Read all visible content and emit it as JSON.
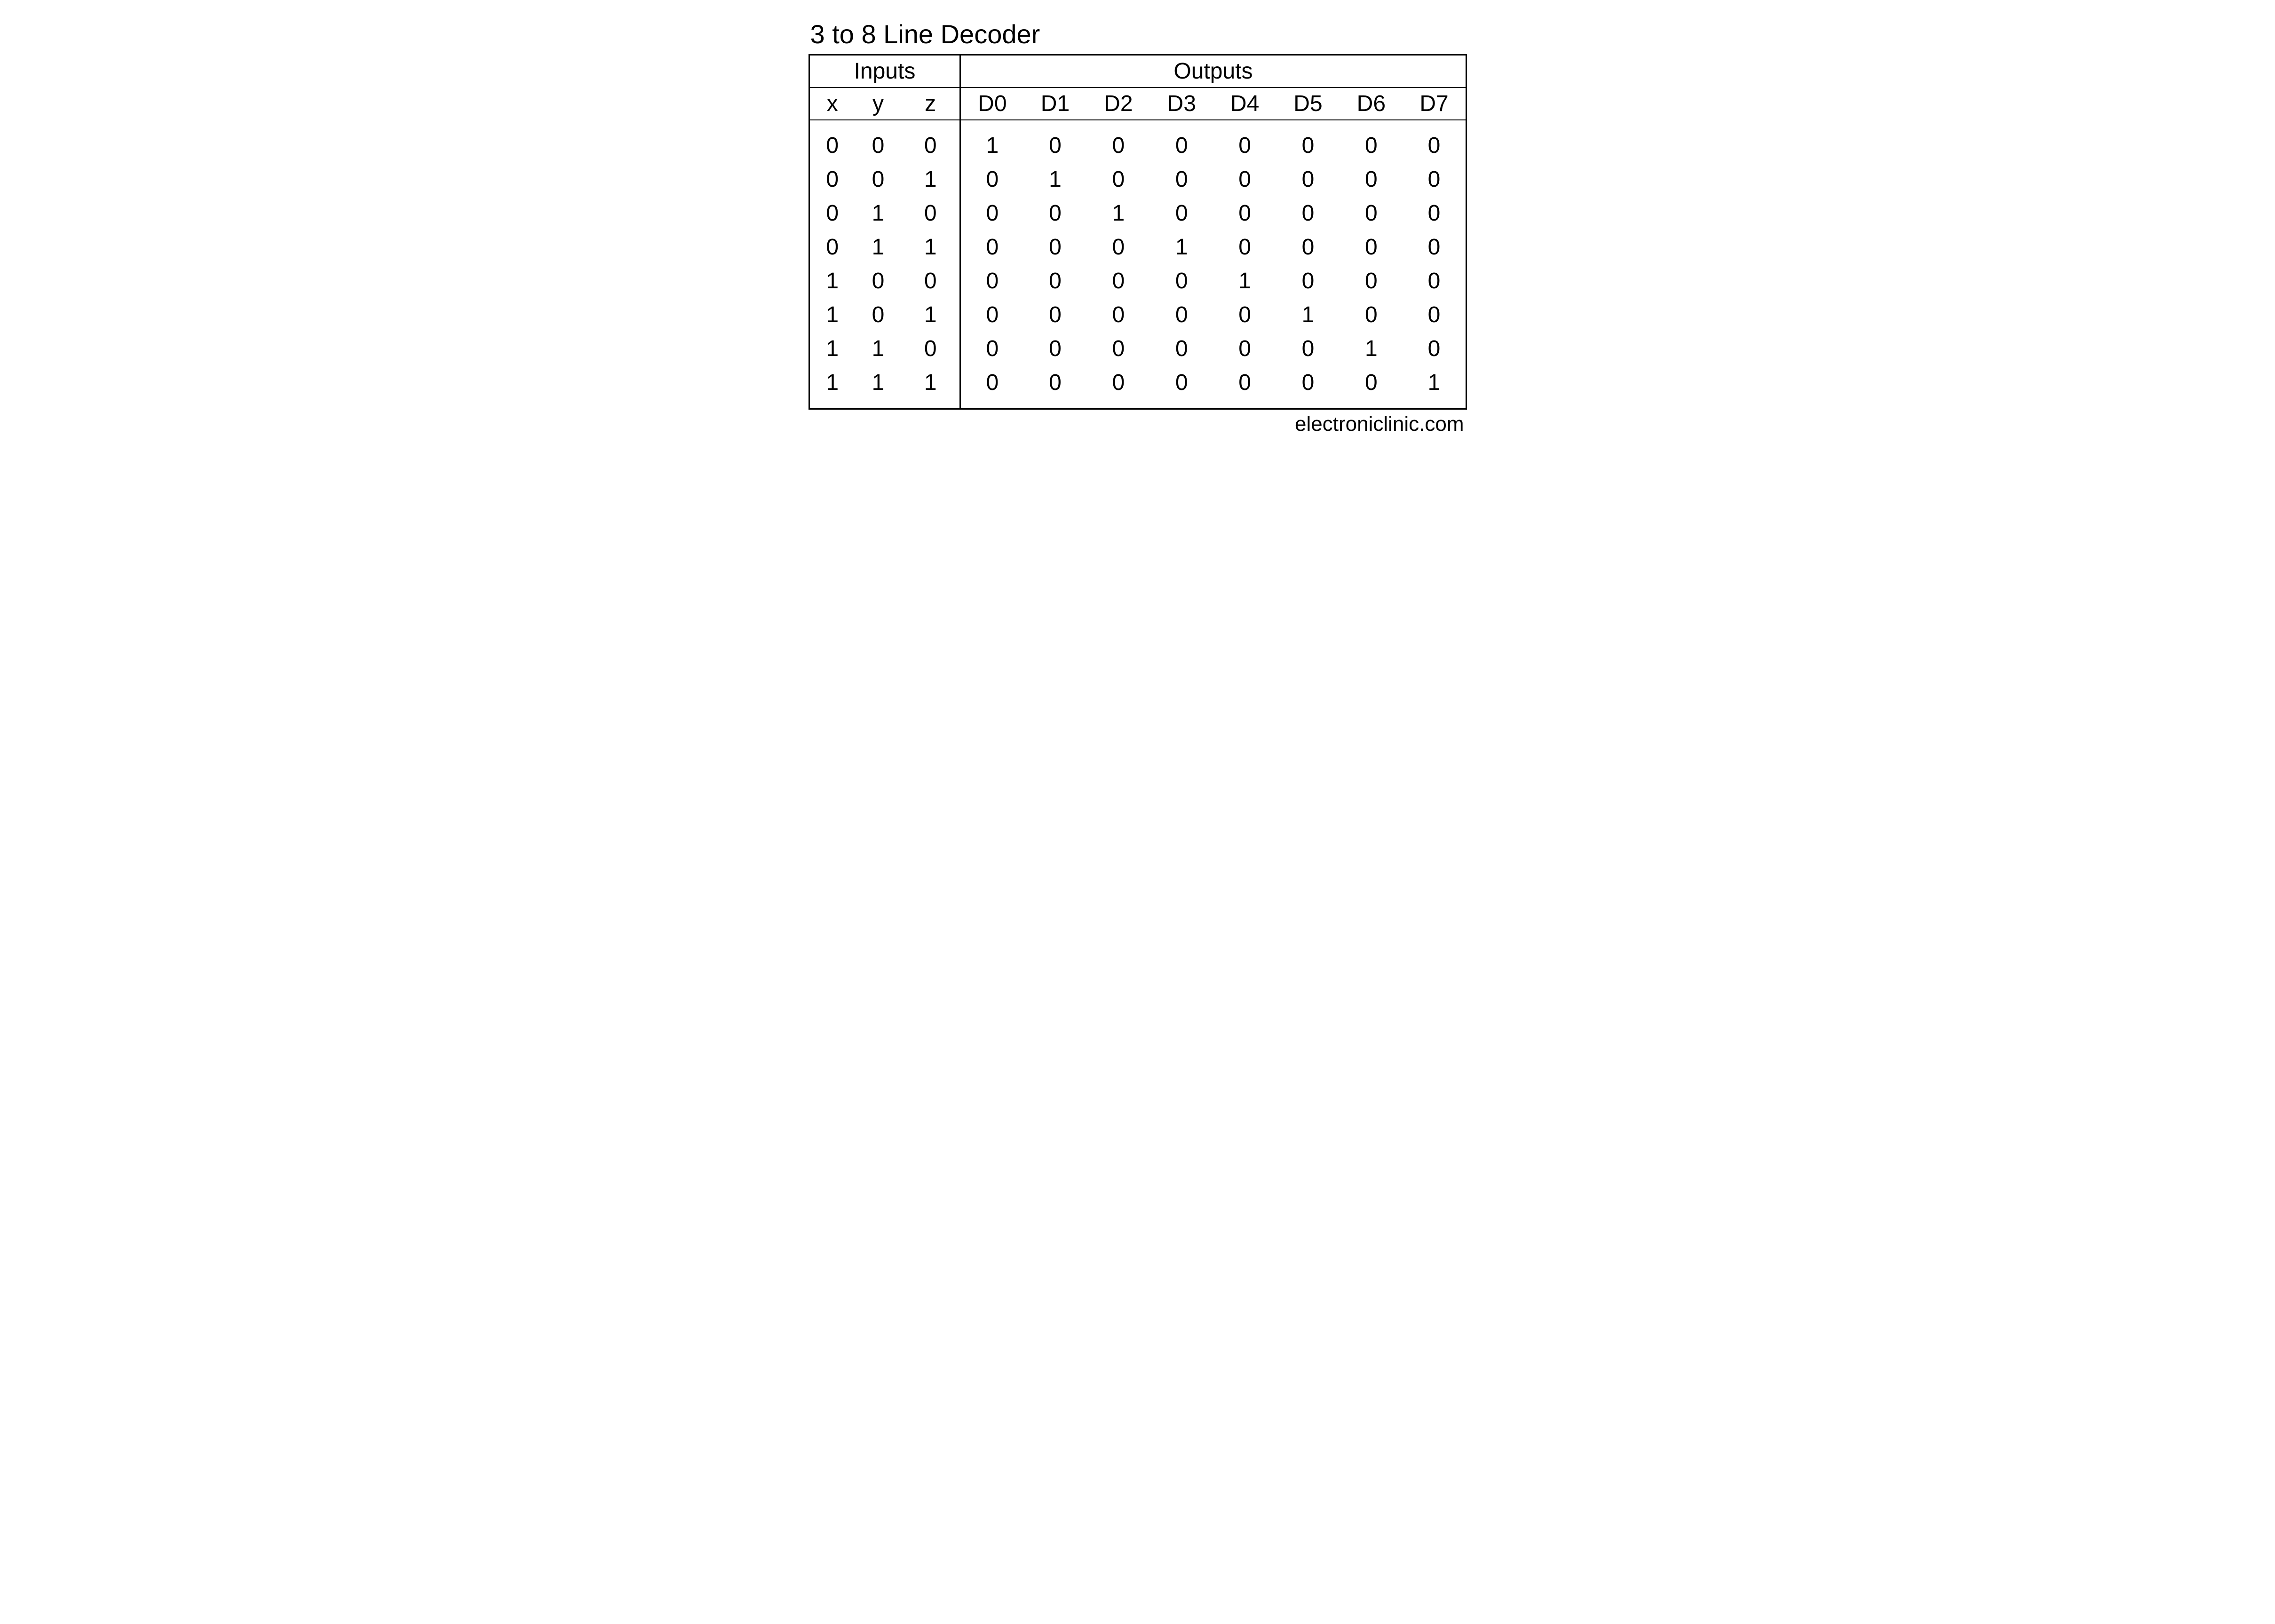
{
  "title": "3 to 8 Line Decoder",
  "credit": "electroniclinic.com",
  "groups": {
    "inputs": "Inputs",
    "outputs": "Outputs"
  },
  "inputs": [
    "x",
    "y",
    "z"
  ],
  "outputs": [
    "D0",
    "D1",
    "D2",
    "D3",
    "D4",
    "D5",
    "D6",
    "D7"
  ],
  "rows": [
    {
      "in": [
        0,
        0,
        0
      ],
      "out": [
        1,
        0,
        0,
        0,
        0,
        0,
        0,
        0
      ]
    },
    {
      "in": [
        0,
        0,
        1
      ],
      "out": [
        0,
        1,
        0,
        0,
        0,
        0,
        0,
        0
      ]
    },
    {
      "in": [
        0,
        1,
        0
      ],
      "out": [
        0,
        0,
        1,
        0,
        0,
        0,
        0,
        0
      ]
    },
    {
      "in": [
        0,
        1,
        1
      ],
      "out": [
        0,
        0,
        0,
        1,
        0,
        0,
        0,
        0
      ]
    },
    {
      "in": [
        1,
        0,
        0
      ],
      "out": [
        0,
        0,
        0,
        0,
        1,
        0,
        0,
        0
      ]
    },
    {
      "in": [
        1,
        0,
        1
      ],
      "out": [
        0,
        0,
        0,
        0,
        0,
        1,
        0,
        0
      ]
    },
    {
      "in": [
        1,
        1,
        0
      ],
      "out": [
        0,
        0,
        0,
        0,
        0,
        0,
        1,
        0
      ]
    },
    {
      "in": [
        1,
        1,
        1
      ],
      "out": [
        0,
        0,
        0,
        0,
        0,
        0,
        0,
        1
      ]
    }
  ],
  "chart_data": {
    "type": "table",
    "title": "3 to 8 Line Decoder",
    "columns": [
      "x",
      "y",
      "z",
      "D0",
      "D1",
      "D2",
      "D3",
      "D4",
      "D5",
      "D6",
      "D7"
    ],
    "data": [
      [
        0,
        0,
        0,
        1,
        0,
        0,
        0,
        0,
        0,
        0,
        0
      ],
      [
        0,
        0,
        1,
        0,
        1,
        0,
        0,
        0,
        0,
        0,
        0
      ],
      [
        0,
        1,
        0,
        0,
        0,
        1,
        0,
        0,
        0,
        0,
        0
      ],
      [
        0,
        1,
        1,
        0,
        0,
        0,
        1,
        0,
        0,
        0,
        0
      ],
      [
        1,
        0,
        0,
        0,
        0,
        0,
        0,
        1,
        0,
        0,
        0
      ],
      [
        1,
        0,
        1,
        0,
        0,
        0,
        0,
        0,
        1,
        0,
        0
      ],
      [
        1,
        1,
        0,
        0,
        0,
        0,
        0,
        0,
        0,
        1,
        0
      ],
      [
        1,
        1,
        1,
        0,
        0,
        0,
        0,
        0,
        0,
        0,
        1
      ]
    ]
  }
}
